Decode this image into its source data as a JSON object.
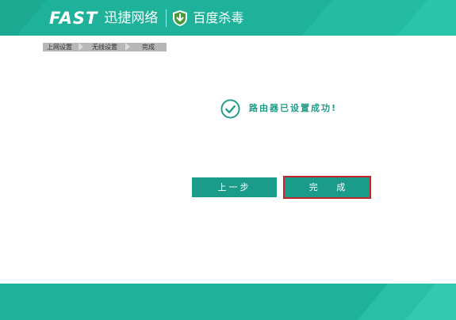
{
  "header": {
    "brand_logo": "FAST",
    "brand_name_cn": "迅捷网络",
    "partner_name": "百度杀毒",
    "colors": {
      "header_bg": "#1fb29a",
      "shield": "#4a9a3a"
    }
  },
  "breadcrumb": {
    "items": [
      "上网设置",
      "无线设置",
      "完成"
    ]
  },
  "status": {
    "message": "路由器已设置成功!",
    "icon": "check-circle-icon",
    "color": "#1f9a88"
  },
  "buttons": {
    "prev_label": "上一步",
    "finish_label": "完 成",
    "button_color": "#1b9b8a",
    "highlight_color": "#c4252c"
  },
  "footer": {
    "color": "#1fb29a"
  }
}
